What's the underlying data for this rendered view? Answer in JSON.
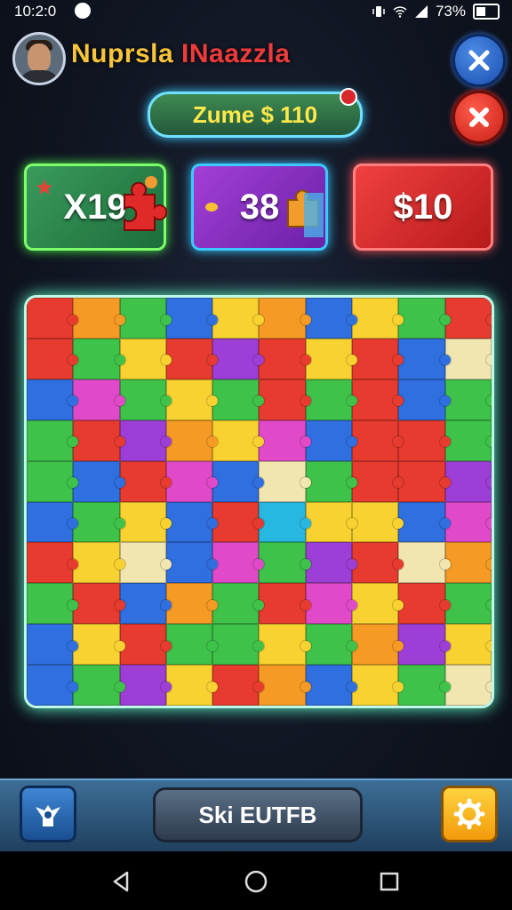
{
  "status_bar": {
    "time": "10:2:0",
    "battery_text": "73%",
    "icons": [
      "app-notification-icon",
      "vibrate-icon",
      "wifi-icon",
      "signal-icon",
      "battery-icon"
    ]
  },
  "header": {
    "title_part1": "Nuprsla",
    "title_part2": "INaazzla",
    "title_color1": "#f7c43a",
    "title_color2": "#ef3b3b",
    "avatar_icon": "player-avatar"
  },
  "score_pill": {
    "label": "Zume $ 110"
  },
  "stats": [
    {
      "label": "X19",
      "color": "#3a9a5c"
    },
    {
      "label": "38",
      "color": "#a33fd6"
    },
    {
      "label": "$10",
      "color": "#f04040"
    }
  ],
  "buttons": {
    "close_blue_icon": "close-icon",
    "close_red_icon": "close-icon",
    "bottom_left_icon": "helper-icon",
    "bottom_center_label": "Ski EUTFB",
    "bottom_right_icon": "gear-icon"
  },
  "board": {
    "rows": 10,
    "cols": 10,
    "palette": [
      "#e63b2e",
      "#f59a24",
      "#f7d230",
      "#3ec24a",
      "#2f6fe0",
      "#9d3fd6",
      "#e04ac8",
      "#27b7e0",
      "#f2e6b0"
    ],
    "grid": [
      [
        0,
        1,
        3,
        4,
        2,
        1,
        4,
        2,
        3,
        0
      ],
      [
        0,
        3,
        2,
        0,
        5,
        0,
        2,
        0,
        4,
        8
      ],
      [
        4,
        6,
        3,
        2,
        3,
        0,
        3,
        0,
        4,
        3
      ],
      [
        3,
        0,
        5,
        1,
        2,
        6,
        4,
        0,
        0,
        3
      ],
      [
        3,
        4,
        0,
        6,
        4,
        8,
        3,
        0,
        0,
        5
      ],
      [
        4,
        3,
        2,
        4,
        0,
        7,
        2,
        2,
        4,
        6
      ],
      [
        0,
        2,
        8,
        4,
        6,
        3,
        5,
        0,
        8,
        1
      ],
      [
        3,
        0,
        4,
        1,
        3,
        0,
        6,
        2,
        0,
        3
      ],
      [
        4,
        2,
        0,
        3,
        3,
        2,
        3,
        1,
        5,
        2
      ],
      [
        4,
        3,
        5,
        2,
        0,
        1,
        4,
        2,
        3,
        8
      ]
    ]
  },
  "nav": {
    "back_icon": "back-icon",
    "home_icon": "home-icon",
    "recent_icon": "recent-apps-icon"
  }
}
